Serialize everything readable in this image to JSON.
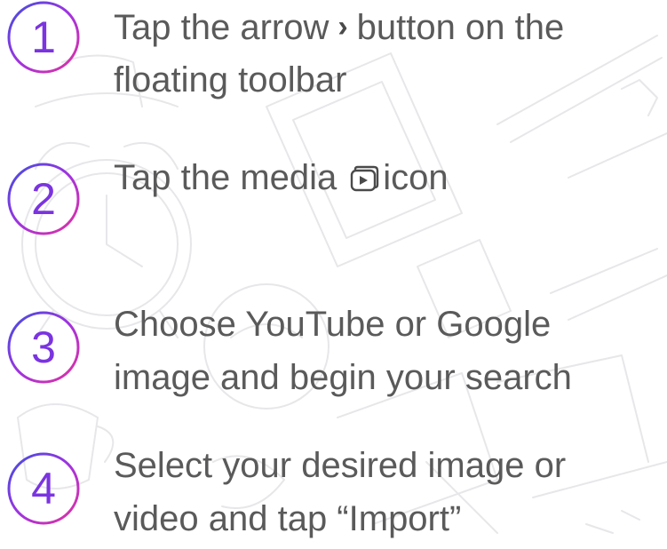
{
  "colors": {
    "text": "#5a5a5a",
    "badge_gradient_start": "#3f4fe0",
    "badge_gradient_mid": "#a032e0",
    "badge_gradient_end": "#e2329e",
    "doodle_stroke": "#e7e7ea"
  },
  "icons": {
    "arrow": "chevron-right-icon",
    "media": "media-play-icon"
  },
  "steps": [
    {
      "number": "1",
      "line1_before": "Tap the arrow",
      "line1_after": "button on the",
      "line2": "floating toolbar"
    },
    {
      "number": "2",
      "line1_before": "Tap the media",
      "line1_after": "icon"
    },
    {
      "number": "3",
      "line1": "Choose YouTube or Google",
      "line2": "image and begin your search"
    },
    {
      "number": "4",
      "line1": "Select your desired image or",
      "line2": "video and tap “Import”"
    }
  ]
}
